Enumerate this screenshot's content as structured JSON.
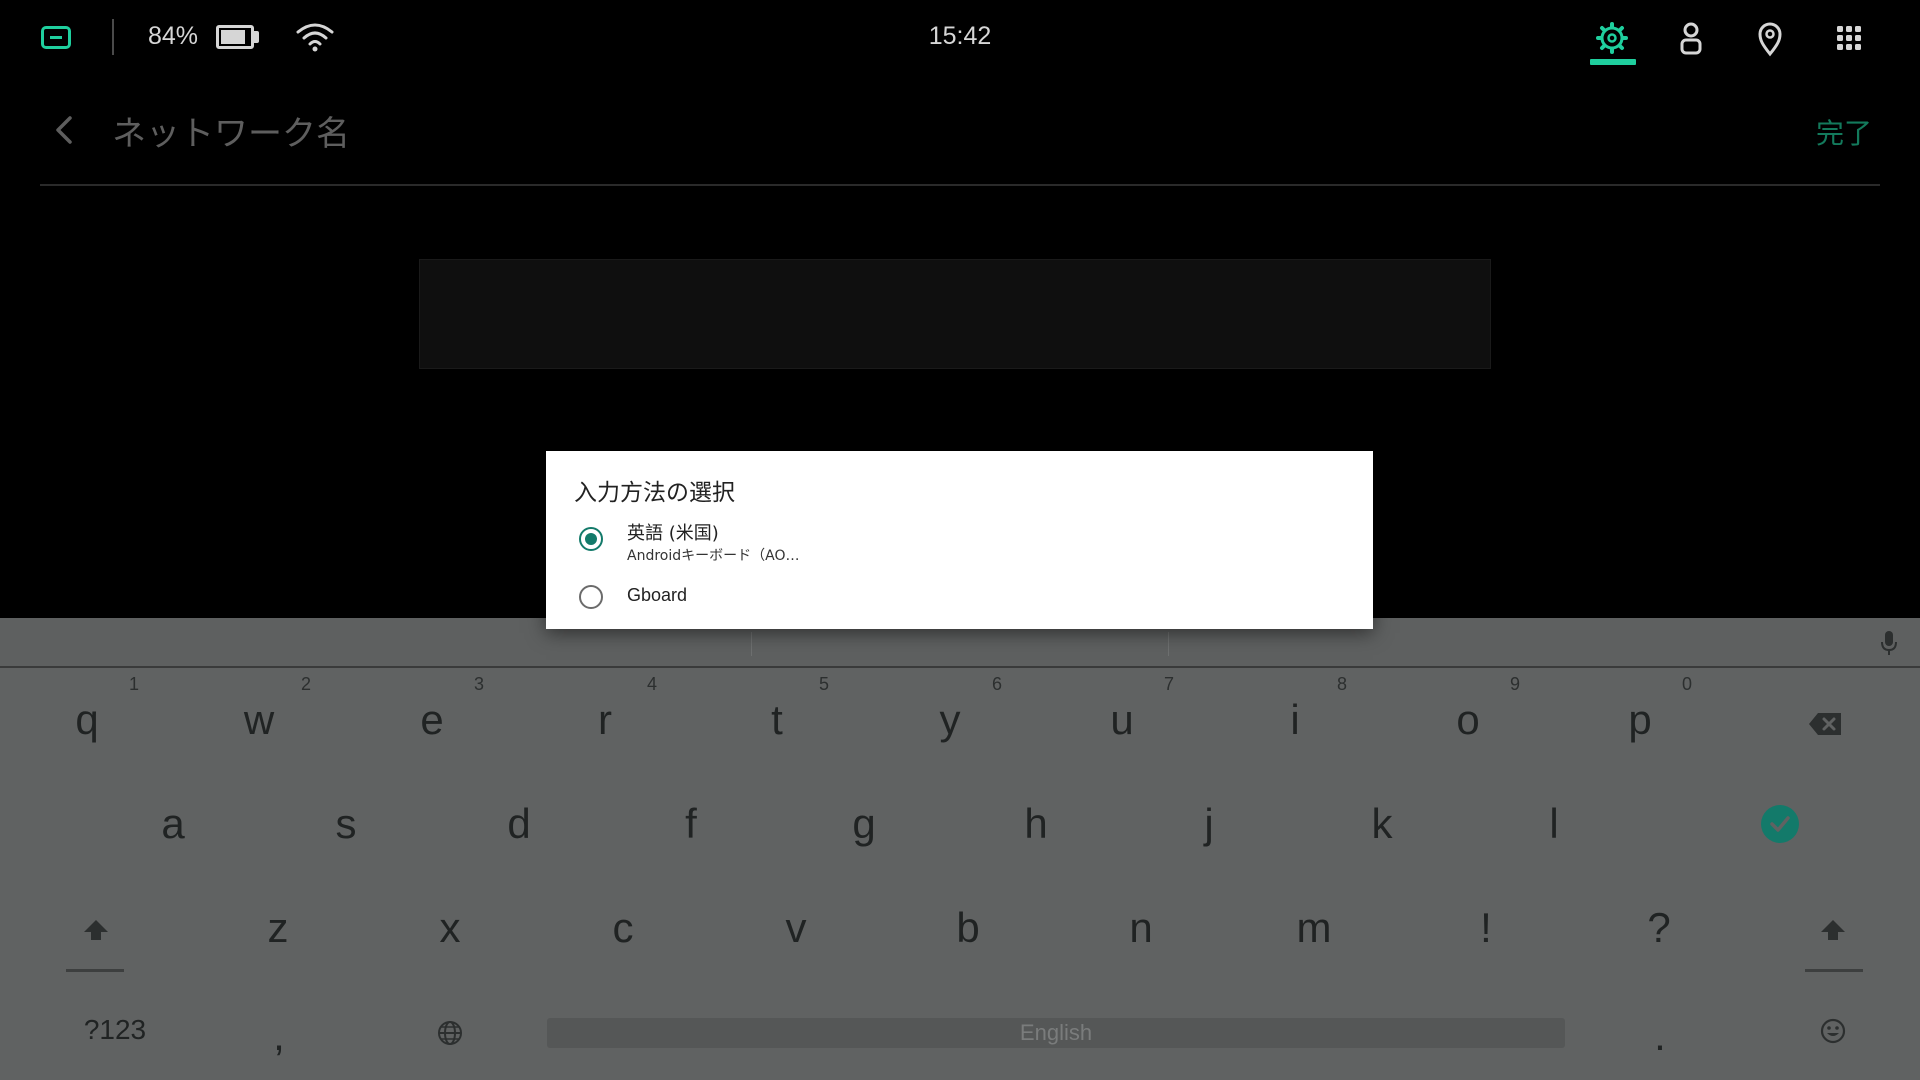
{
  "status_bar": {
    "battery_percent": "84%",
    "battery_level": 0.84,
    "clock": "15:42",
    "accent_color": "#1fcf9e",
    "icons": [
      "screen-icon",
      "battery-icon",
      "wifi-icon",
      "gear-icon",
      "person-icon",
      "location-pin-icon",
      "apps-grid-icon"
    ]
  },
  "header": {
    "title": "ネットワーク名",
    "done_label": "完了"
  },
  "input_dialog": {
    "title": "入力方法の選択",
    "options": [
      {
        "label": "英語 (米国)",
        "sublabel": "Androidキーボード（AO…",
        "selected": true
      },
      {
        "label": "Gboard",
        "selected": false
      }
    ],
    "accent_color": "#137a6a"
  },
  "keyboard": {
    "row1": [
      {
        "ch": "q",
        "hint": "1"
      },
      {
        "ch": "w",
        "hint": "2"
      },
      {
        "ch": "e",
        "hint": "3"
      },
      {
        "ch": "r",
        "hint": "4"
      },
      {
        "ch": "t",
        "hint": "5"
      },
      {
        "ch": "y",
        "hint": "6"
      },
      {
        "ch": "u",
        "hint": "7"
      },
      {
        "ch": "i",
        "hint": "8"
      },
      {
        "ch": "o",
        "hint": "9"
      },
      {
        "ch": "p",
        "hint": "0"
      }
    ],
    "row2": [
      "a",
      "s",
      "d",
      "f",
      "g",
      "h",
      "j",
      "k",
      "l"
    ],
    "row3": [
      "z",
      "x",
      "c",
      "v",
      "b",
      "n",
      "m",
      "!",
      "?"
    ],
    "symbols_label": "?123",
    "comma_label": ",",
    "period_label": ".",
    "space_label": "English",
    "enter_color": "#137a6a"
  }
}
